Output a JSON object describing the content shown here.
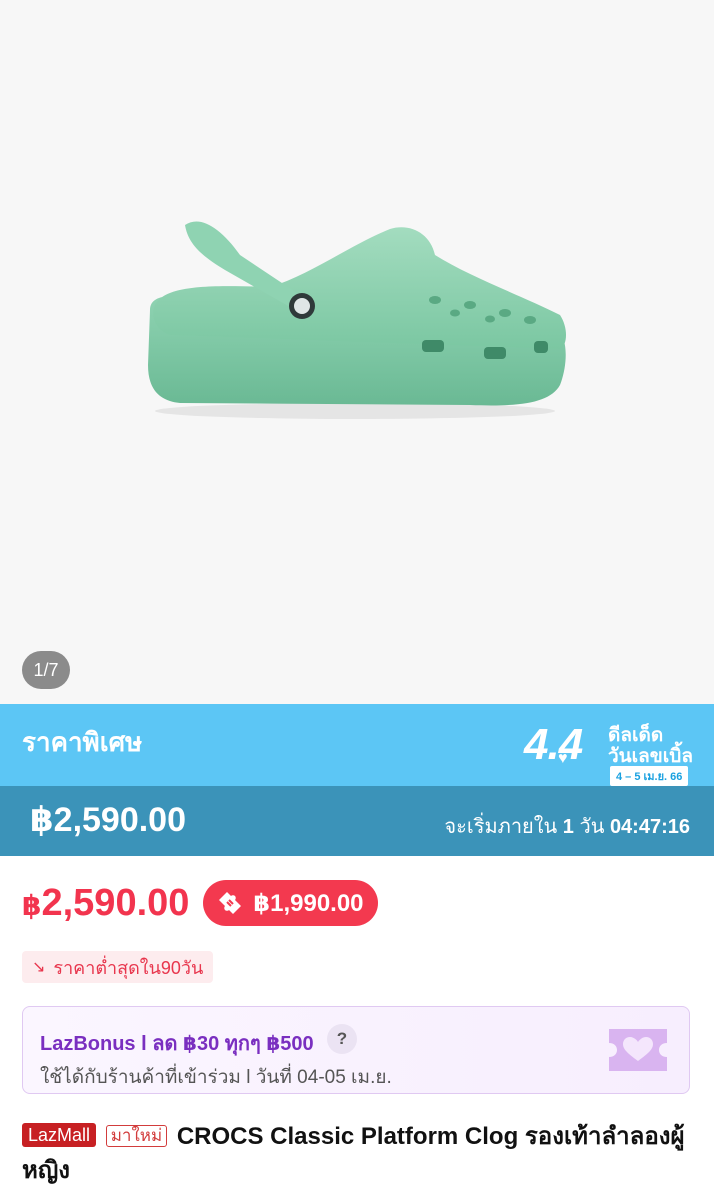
{
  "gallery": {
    "counter": "1/7"
  },
  "promo": {
    "label": "ราคาพิเศษ",
    "badge_big": "4.4",
    "badge_line1": "ดีลเด็ด",
    "badge_line2": "วันเลขเบิ้ล",
    "badge_date": "4 – 5 เม.ย. 66",
    "price": "฿2,590.00",
    "countdown_prefix": "จะเริ่มภายใน",
    "countdown_days": "1",
    "countdown_unit": "วัน",
    "countdown_time": "04:47:16",
    "colors": {
      "top": "#5cc6f5",
      "bottom": "#3b93b9"
    }
  },
  "pricing": {
    "currency": "฿",
    "price": "2,590.00",
    "voucher_price": "฿1,990.00",
    "lowest_tag": "ราคาต่ำสุดใน90วัน",
    "accent": "#f2344e"
  },
  "bonus": {
    "title": "LazBonus l ลด ฿30 ทุกๆ ฿500",
    "help": "?",
    "subtitle": "ใช้ได้กับร้านค้าที่เข้าร่วม l วันที่ 04-05 เม.ย."
  },
  "product": {
    "mall_badge": "LazMall",
    "new_badge": "มาใหม่",
    "title": "CROCS Classic Platform Clog รองเท้าลำลองผู้หญิง"
  }
}
